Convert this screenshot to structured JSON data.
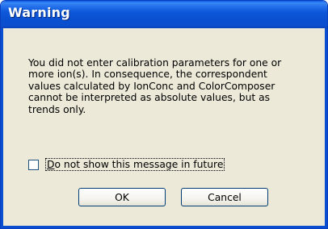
{
  "window": {
    "title": "Warning"
  },
  "message": {
    "lines": [
      "You did not enter calibration parameters for one or",
      "more ion(s). In consequence, the correspondent",
      "values calculated by IonConc and ColorComposer",
      "cannot be interpreted as absolute values, but as",
      "trends only."
    ]
  },
  "checkbox": {
    "mnemonic": "D",
    "label_rest": "o not show this message in future",
    "checked": false
  },
  "buttons": {
    "ok_label": "OK",
    "cancel_label": "Cancel"
  },
  "colors": {
    "titlebar": "#0a4fd0",
    "dialog_bg": "#ece9d8",
    "button_border": "#003c74"
  }
}
